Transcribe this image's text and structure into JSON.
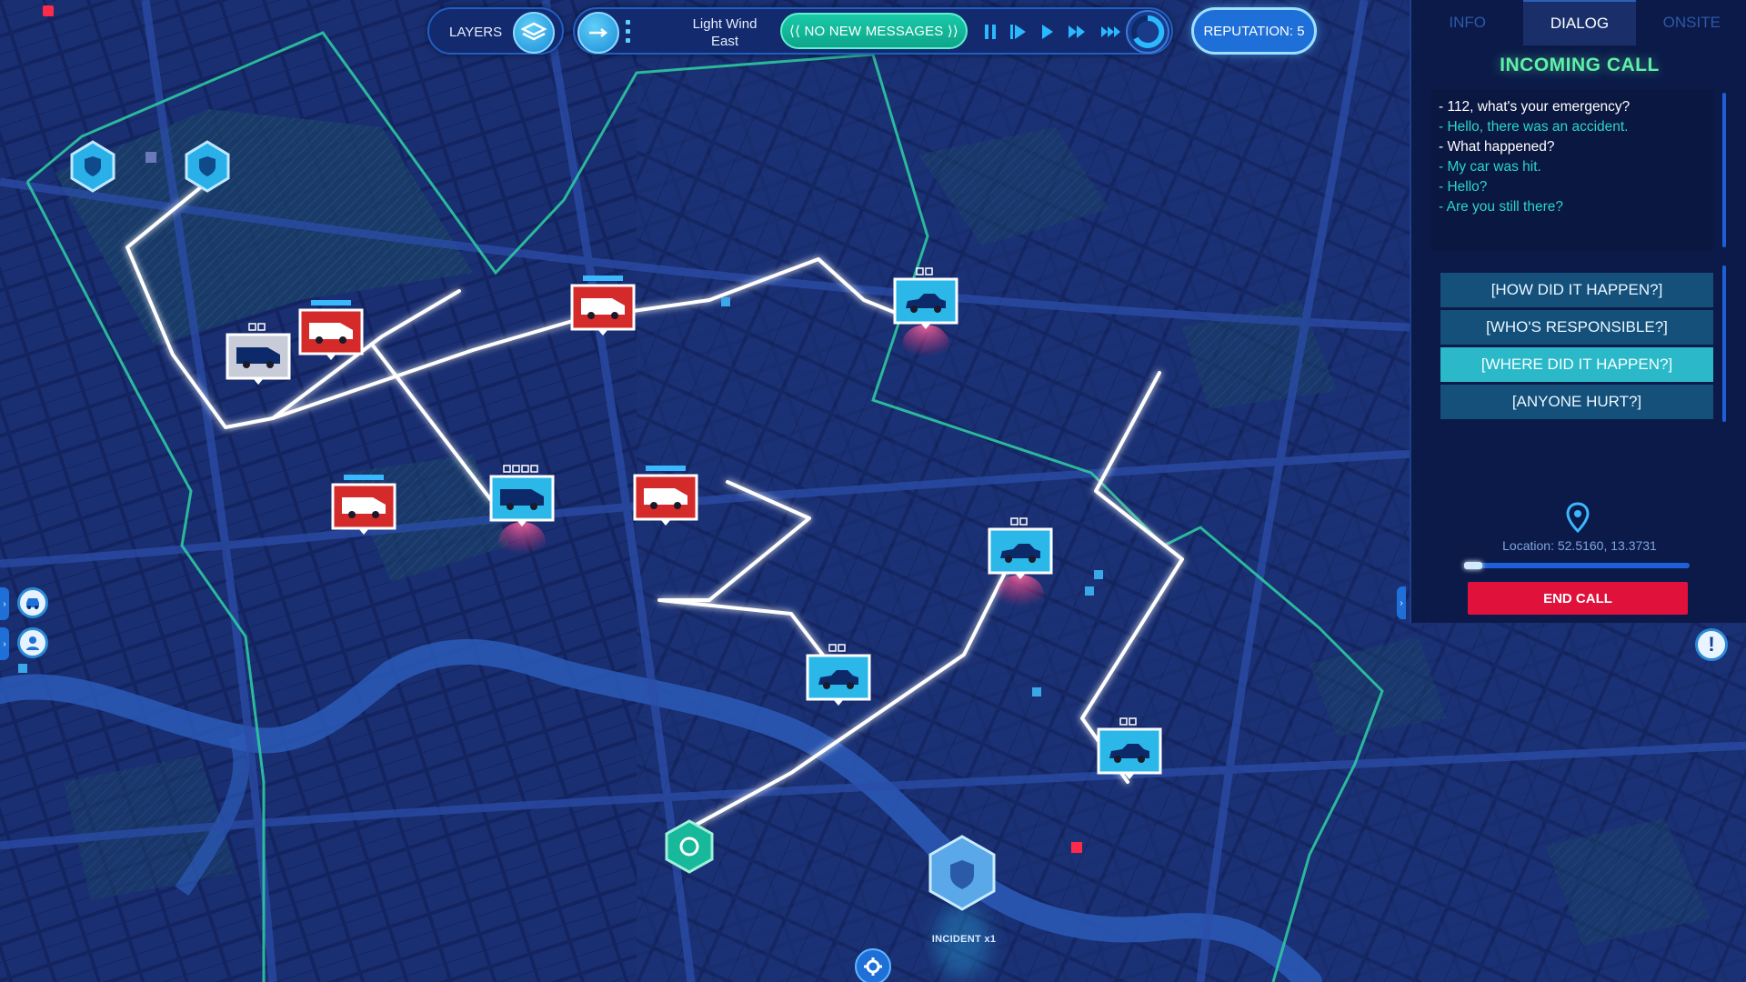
{
  "top_bar": {
    "layers_label": "LAYERS",
    "wind_line1": "Light Wind",
    "wind_line2": "East",
    "messages_label": "⟨⟨ NO NEW MESSAGES ⟩⟩",
    "reputation_label": "REPUTATION: 5",
    "speed_controls": [
      "pause-icon",
      "step-icon",
      "play-icon",
      "fast-forward-icon",
      "fastest-forward-icon"
    ]
  },
  "panel": {
    "tabs": [
      {
        "label": "INFO",
        "active": false
      },
      {
        "label": "DIALOG",
        "active": true
      },
      {
        "label": "ONSITE",
        "active": false
      }
    ],
    "call_title": "INCOMING CALL",
    "transcript": [
      {
        "speaker": "operator",
        "text": "- 112, what's your emergency?"
      },
      {
        "speaker": "caller",
        "text": "- Hello, there was an accident."
      },
      {
        "speaker": "operator",
        "text": "- What happened?"
      },
      {
        "speaker": "caller",
        "text": "- My car was hit."
      },
      {
        "speaker": "caller",
        "text": "- Hello?"
      },
      {
        "speaker": "caller",
        "text": "- Are you still there?"
      }
    ],
    "options": [
      {
        "label": "[HOW DID IT HAPPEN?]",
        "selected": false
      },
      {
        "label": "[WHO'S RESPONSIBLE?]",
        "selected": false
      },
      {
        "label": "[WHERE DID IT HAPPEN?]",
        "selected": true
      },
      {
        "label": "[ANYONE HURT?]",
        "selected": false
      }
    ],
    "location_text": "Location: 52.5160, 13.3731",
    "location_progress": 0.08,
    "end_call_label": "END CALL"
  },
  "map": {
    "incident_label": "INCIDENT x1",
    "colors": {
      "background": "#0f1d4a",
      "district_border": "#2ec9a0",
      "route": "#ffffff",
      "police": "#2bb8e8",
      "fire": "#d42a2a",
      "ambulance": "#c8ccd8"
    },
    "units": [
      {
        "type": "ambulance",
        "icon": "ambulance-icon"
      },
      {
        "type": "fire",
        "icon": "fire-truck-icon"
      },
      {
        "type": "fire",
        "icon": "fire-truck-icon"
      },
      {
        "type": "police",
        "icon": "police-car-icon"
      },
      {
        "type": "fire",
        "icon": "fire-truck-icon"
      },
      {
        "type": "police-van",
        "icon": "police-van-icon"
      },
      {
        "type": "fire",
        "icon": "fire-truck-icon"
      },
      {
        "type": "police",
        "icon": "police-car-icon"
      },
      {
        "type": "police",
        "icon": "police-car-icon"
      },
      {
        "type": "police",
        "icon": "police-car-icon"
      }
    ]
  }
}
